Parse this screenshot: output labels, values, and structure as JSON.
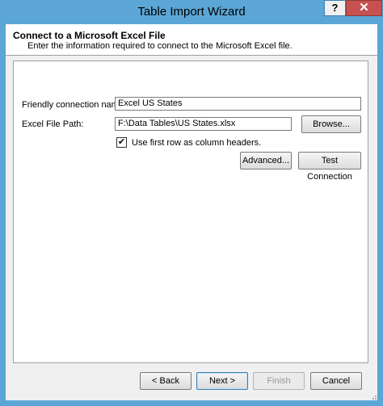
{
  "window": {
    "title": "Table Import Wizard",
    "help_label": "?",
    "close_label": "✕"
  },
  "header": {
    "title": "Connect to a Microsoft Excel File",
    "subtitle": "Enter the information required to connect to the Microsoft Excel file."
  },
  "form": {
    "friendly_label": "Friendly connection name:",
    "friendly_value": "Excel US States",
    "path_label": "Excel File Path:",
    "path_value": "F:\\Data Tables\\US States.xlsx",
    "browse_label": "Browse...",
    "first_row_checked": true,
    "first_row_label": "Use first row as column headers.",
    "advanced_label": "Advanced...",
    "test_label": "Test Connection"
  },
  "footer": {
    "back_label": "< Back",
    "next_label": "Next >",
    "finish_label": "Finish",
    "cancel_label": "Cancel"
  },
  "icons": {
    "check": "check-icon",
    "close": "close-icon",
    "help": "help-icon"
  }
}
